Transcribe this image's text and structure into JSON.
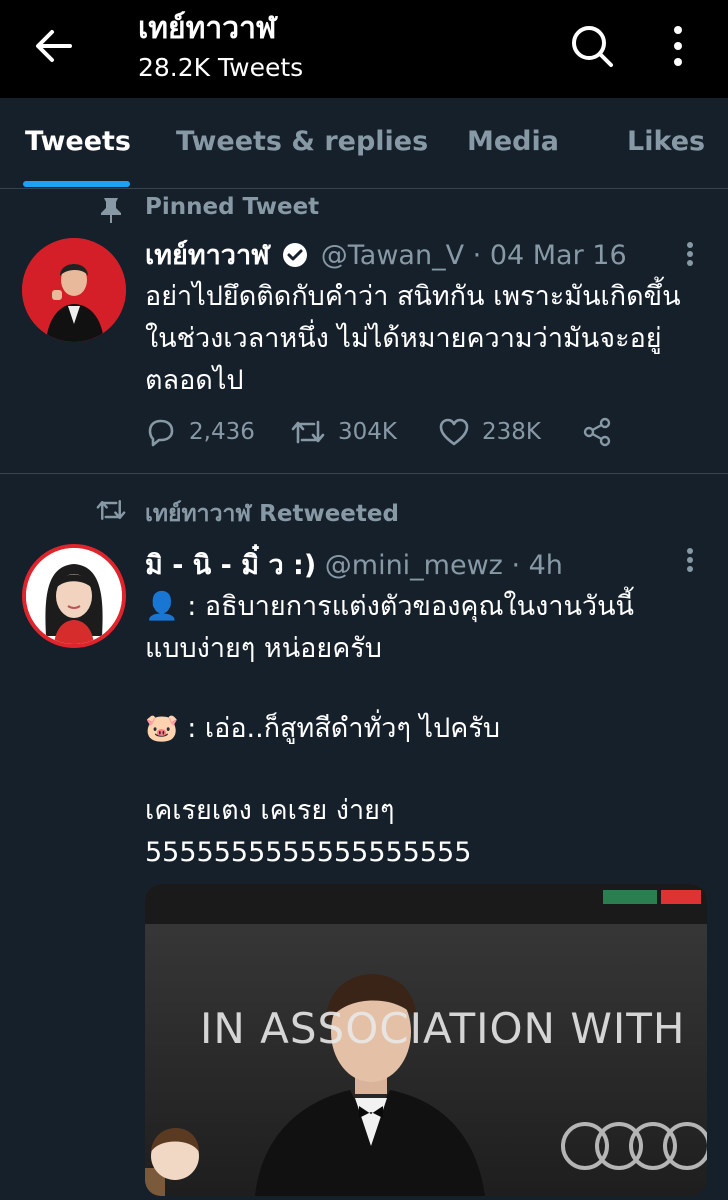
{
  "header": {
    "title": "เทย์ทาวาฬ",
    "subtitle": "28.2K Tweets"
  },
  "tabs": [
    {
      "label": "Tweets",
      "active": true
    },
    {
      "label": "Tweets & replies"
    },
    {
      "label": "Media"
    },
    {
      "label": "Likes"
    }
  ],
  "pinned": {
    "context": "Pinned Tweet",
    "name": "เทย์ทาวาฬ",
    "handle": "@Tawan_V",
    "date": "· 04 Mar 16",
    "text": "อย่าไปยึดติดกับคำว่า สนิทกัน เพราะมันเกิดขึ้นในช่วงเวลาหนึ่ง ไม่ได้หมายความว่ามันจะอยู่ตลอดไป",
    "replies": "2,436",
    "retweets": "304K",
    "likes": "238K"
  },
  "retweet": {
    "context": "เทย์ทาวาฬ Retweeted",
    "name": "มิ - นิ - มิ๋ ว :)",
    "handle": "@mini_mewz",
    "time": "· 4h",
    "lines": [
      "👤 : อธิบายการแต่งตัวของคุณในงานวันนี้",
      "แบบง่ายๆ หน่อยครับ",
      "🐷 : เอ่อ..ก็สูทสีดำทั่วๆ ไปครับ",
      "เคเรยเตง เคเรย ง่ายๆ",
      "5555555555555555555"
    ],
    "image_text": "IN ASSOCIATION WITH"
  },
  "colors": {
    "bg": "#15202b",
    "header": "#000000",
    "accent": "#1da1f2",
    "muted": "#8899a6"
  }
}
